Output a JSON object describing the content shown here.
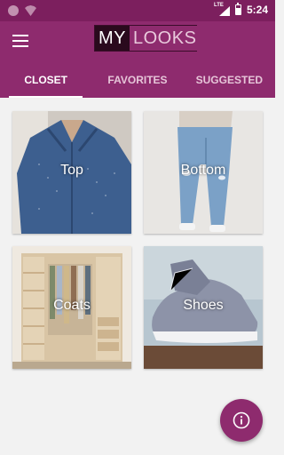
{
  "status_bar": {
    "time": "5:24",
    "network": "LTE",
    "icons": [
      "notification-dot-icon",
      "wifi-off-icon",
      "signal-icon",
      "battery-icon"
    ]
  },
  "app_bar": {
    "logo_my": "MY",
    "logo_looks": "LOOKS",
    "menu_icon": "hamburger-menu-icon"
  },
  "tabs": [
    {
      "label": "CLOSET",
      "active": true
    },
    {
      "label": "FAVORITES",
      "active": false
    },
    {
      "label": "SUGGESTED",
      "active": false
    }
  ],
  "categories": [
    {
      "label": "Top"
    },
    {
      "label": "Bottom"
    },
    {
      "label": "Coats"
    },
    {
      "label": "Shoes"
    }
  ],
  "fab": {
    "icon": "info-icon"
  },
  "colors": {
    "primary": "#8e2b6e",
    "primary_dark": "#7c1f5e",
    "background": "#f2f2f2"
  }
}
